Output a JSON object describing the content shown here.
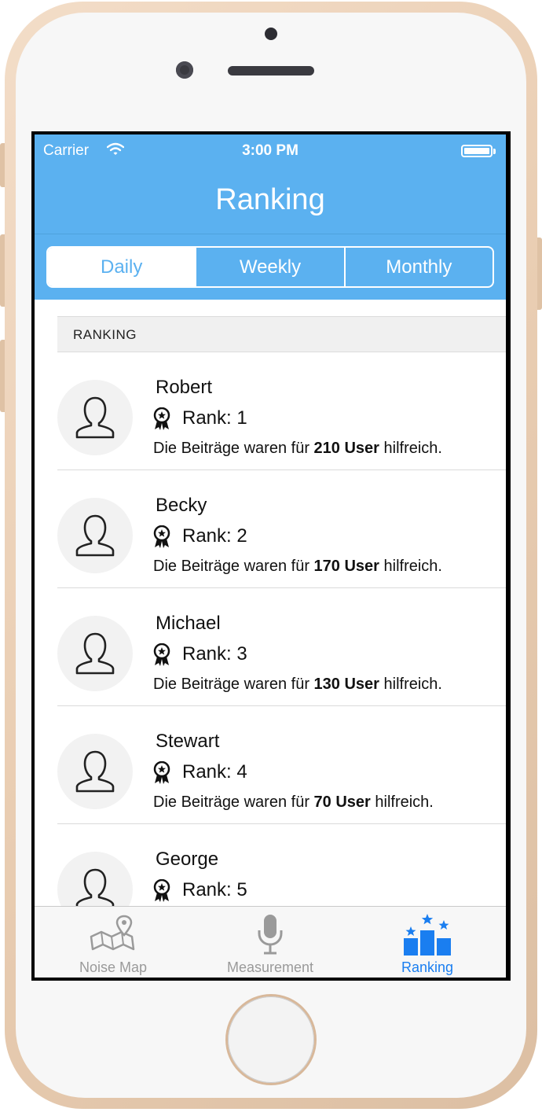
{
  "status_bar": {
    "carrier": "Carrier",
    "time": "3:00 PM"
  },
  "nav": {
    "title": "Ranking"
  },
  "segments": [
    {
      "label": "Daily",
      "active": true
    },
    {
      "label": "Weekly",
      "active": false
    },
    {
      "label": "Monthly",
      "active": false
    }
  ],
  "section": {
    "title": "RANKING"
  },
  "users": [
    {
      "name": "Robert",
      "rank": "Rank: 1",
      "desc_prefix": "Die Beiträge waren für ",
      "desc_bold": "210 User",
      "desc_suffix": " hilfreich."
    },
    {
      "name": "Becky",
      "rank": "Rank: 2",
      "desc_prefix": "Die Beiträge waren für ",
      "desc_bold": "170 User",
      "desc_suffix": " hilfreich."
    },
    {
      "name": "Michael",
      "rank": "Rank: 3",
      "desc_prefix": "Die Beiträge waren für ",
      "desc_bold": "130 User",
      "desc_suffix": " hilfreich."
    },
    {
      "name": "Stewart",
      "rank": "Rank: 4",
      "desc_prefix": "Die Beiträge waren für ",
      "desc_bold": "70 User",
      "desc_suffix": " hilfreich."
    },
    {
      "name": "George",
      "rank": "Rank: 5",
      "desc_prefix": "",
      "desc_bold": "",
      "desc_suffix": ""
    }
  ],
  "tabs": [
    {
      "label": "Noise Map",
      "icon": "map-pin-icon",
      "active": false
    },
    {
      "label": "Measurement",
      "icon": "microphone-icon",
      "active": false
    },
    {
      "label": "Ranking",
      "icon": "podium-stars-icon",
      "active": true
    }
  ],
  "colors": {
    "header_blue": "#5bb1f0",
    "tab_active": "#1a7ef0",
    "tab_inactive": "#9a9a9a"
  }
}
